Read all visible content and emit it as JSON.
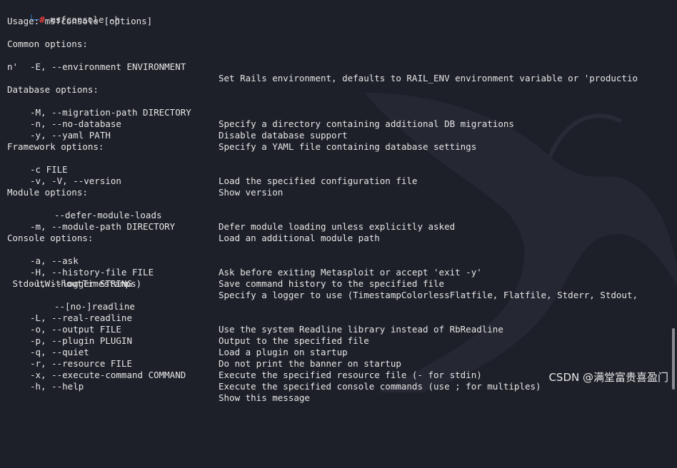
{
  "terminal": {
    "prompt": {
      "corner": "└─",
      "hash": "#",
      "command": "msfconsole -h"
    },
    "usage": "Usage: msfconsole [options]",
    "sections": {
      "common": {
        "title": "Common options:",
        "opts": [
          {
            "flag": "-E, --environment ENVIRONMENT",
            "desc": "Set Rails environment, defaults to RAIL_ENV environment variable or 'productio"
          }
        ],
        "wrap": "n'"
      },
      "database": {
        "title": "Database options:",
        "opts": [
          {
            "flag": "-M, --migration-path DIRECTORY",
            "desc": "Specify a directory containing additional DB migrations"
          },
          {
            "flag": "-n, --no-database",
            "desc": "Disable database support"
          },
          {
            "flag": "-y, --yaml PATH",
            "desc": "Specify a YAML file containing database settings"
          }
        ]
      },
      "framework": {
        "title": "Framework options:",
        "opts": [
          {
            "flag": "-c FILE",
            "desc": "Load the specified configuration file"
          },
          {
            "flag": "-v, -V, --version",
            "desc": "Show version"
          }
        ]
      },
      "module": {
        "title": "Module options:",
        "opts": [
          {
            "flag": "--defer-module-loads",
            "desc": "Defer module loading unless explicitly asked"
          },
          {
            "flag": "-m, --module-path DIRECTORY",
            "desc": "Load an additional module path"
          }
        ]
      },
      "console": {
        "title": "Console options:",
        "opts": [
          {
            "flag": "-a, --ask",
            "desc": "Ask before exiting Metasploit or accept 'exit -y'"
          },
          {
            "flag": "-H, --history-file FILE",
            "desc": "Save command history to the specified file"
          },
          {
            "flag": "-l, --logger STRING",
            "desc": "Specify a logger to use (TimestampColorlessFlatfile, Flatfile, Stderr, Stdout,"
          },
          {
            "flag": "--[no-]readline",
            "desc": ""
          },
          {
            "flag": "-L, --real-readline",
            "desc": "Use the system Readline library instead of RbReadline"
          },
          {
            "flag": "-o, --output FILE",
            "desc": "Output to the specified file"
          },
          {
            "flag": "-p, --plugin PLUGIN",
            "desc": "Load a plugin on startup"
          },
          {
            "flag": "-q, --quiet",
            "desc": "Do not print the banner on startup"
          },
          {
            "flag": "-r, --resource FILE",
            "desc": "Execute the specified resource file (- for stdin)"
          },
          {
            "flag": "-x, --execute-command COMMAND",
            "desc": "Execute the specified console commands (use ; for multiples)"
          },
          {
            "flag": "-h, --help",
            "desc": "Show this message"
          }
        ],
        "logger_wrap": " StdoutWithoutTimestamps)"
      }
    }
  },
  "watermark": "CSDN @满堂富贵喜盈门",
  "colors": {
    "background": "#1e2029",
    "prompt_corner": "#2a7bd6",
    "prompt_hash": "#e23b3b",
    "text": "#e6e6e6",
    "dragon": "#2b2d37"
  }
}
